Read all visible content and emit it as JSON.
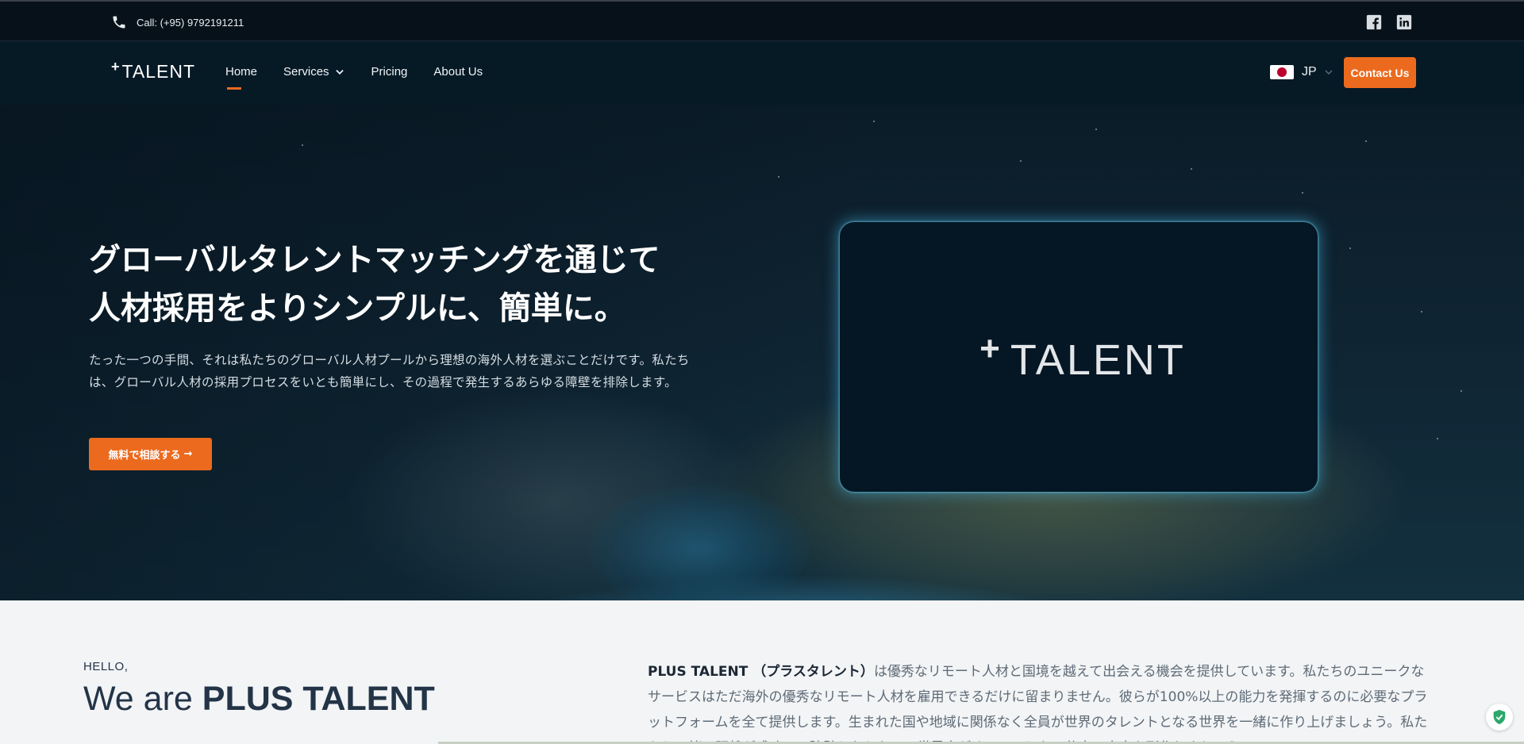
{
  "topbar": {
    "phone": "Call: (+95) 9792191211",
    "social": [
      "facebook-icon",
      "linkedin-icon"
    ]
  },
  "nav": {
    "logo_plus": "+",
    "logo_text": "TALENT",
    "items": [
      {
        "label": "Home",
        "active": true
      },
      {
        "label": "Services",
        "dropdown": true
      },
      {
        "label": "Pricing"
      },
      {
        "label": "About Us"
      }
    ],
    "lang": "JP",
    "contact": "Contact Us"
  },
  "hero": {
    "title_line1": "グローバルタレントマッチングを通じて",
    "title_line2": "人材採用をよりシンプルに、簡単に。",
    "lead": "たった一つの手間、それは私たちのグローバル人材プールから理想の海外人材を選ぶことだけです。私たちは、グローバル人材の採用プロセスをいとも簡単にし、その過程で発生するあらゆる障壁を排除します。",
    "cta": "無料で相談する",
    "cta_arrow": "→",
    "card_logo_plus": "+",
    "card_logo_text": "TALENT"
  },
  "about": {
    "hello": "HELLO,",
    "we_prefix": "We are ",
    "we_name": "PLUS TALENT",
    "desc_bold": "PLUS TALENT （プラスタレント）",
    "desc": "は優秀なリモート人材と国境を越えて出会える機会を提供しています。私たちのユニークなサービスはただ海外の優秀なリモート人材を雇用できるだけに留まりません。彼らが100%以上の能力を発揮するのに必要なプラットフォームを全て提供します。生まれた国や地域に関係なく全員が世界のタレントとなる世界を一緒に作り上げましょう。私たちと一緒に距離が成功への障壁とならない、世界中がオフィスとなる仕事の未来を形作りましょう。"
  },
  "colors": {
    "accent": "#ec6a1e",
    "nav_bg": "#061a26",
    "section_bg": "#f2f4f6"
  }
}
